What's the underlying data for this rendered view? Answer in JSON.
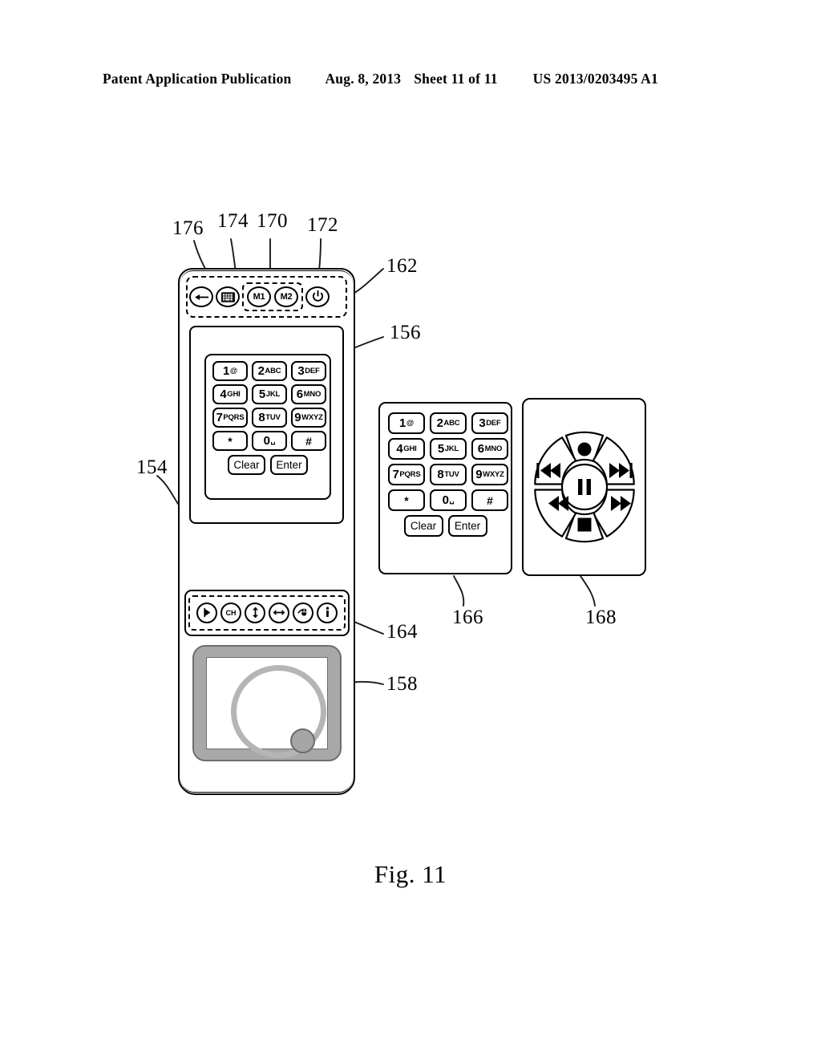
{
  "header": {
    "publication": "Patent Application Publication",
    "date": "Aug. 8, 2013",
    "sheet": "Sheet 11 of 11",
    "number": "US 2013/0203495 A1"
  },
  "figure": {
    "caption": "Fig. 11"
  },
  "reference_numerals": {
    "device_body": "154",
    "screen_panel": "156",
    "trackpad": "158",
    "toolbar_region": "162",
    "icon_strip": "164",
    "keypad_alt": "166",
    "media_panel": "168",
    "memory_group": "170",
    "power_button": "172",
    "keyboard_button": "174",
    "back_button": "176"
  },
  "toolbar": {
    "back_icon": "back-arrow-icon",
    "keyboard_icon": "keyboard-icon",
    "memory": [
      {
        "label": "M1"
      },
      {
        "label": "M2"
      }
    ],
    "power_icon": "power-icon"
  },
  "keypad": {
    "keys": [
      {
        "num": "1",
        "letters": "@"
      },
      {
        "num": "2",
        "letters": "ABC"
      },
      {
        "num": "3",
        "letters": "DEF"
      },
      {
        "num": "4",
        "letters": "GHI"
      },
      {
        "num": "5",
        "letters": "JKL"
      },
      {
        "num": "6",
        "letters": "MNO"
      },
      {
        "num": "7",
        "letters": "PQRS"
      },
      {
        "num": "8",
        "letters": "TUV"
      },
      {
        "num": "9",
        "letters": "WXYZ"
      },
      {
        "num": "*",
        "letters": ""
      },
      {
        "num": "0",
        "letters": "␣"
      },
      {
        "num": "#",
        "letters": ""
      }
    ],
    "clear_label": "Clear",
    "enter_label": "Enter"
  },
  "icon_strip": {
    "icons": [
      {
        "name": "play-flag-icon",
        "label": ""
      },
      {
        "name": "channel-icon",
        "label": "CH"
      },
      {
        "name": "vertical-scroll-icon",
        "label": ""
      },
      {
        "name": "horizontal-scroll-icon",
        "label": ""
      },
      {
        "name": "mouse-pointer-icon",
        "label": ""
      },
      {
        "name": "info-icon",
        "label": ""
      }
    ]
  },
  "trackpad": {
    "name": "trackpad-surface",
    "ring_color": "#b5b5b5",
    "bezel_color": "#a8a8a8",
    "touch_point_color": "#a5a5a5"
  },
  "media_controls": {
    "buttons": [
      {
        "name": "record-button",
        "icon": "record-circle"
      },
      {
        "name": "previous-track-button",
        "icon": "skip-back"
      },
      {
        "name": "next-track-button",
        "icon": "skip-forward"
      },
      {
        "name": "rewind-button",
        "icon": "rewind"
      },
      {
        "name": "fast-forward-button",
        "icon": "fast-forward"
      },
      {
        "name": "stop-button",
        "icon": "stop-square"
      },
      {
        "name": "pause-button",
        "icon": "pause-bars"
      }
    ]
  }
}
